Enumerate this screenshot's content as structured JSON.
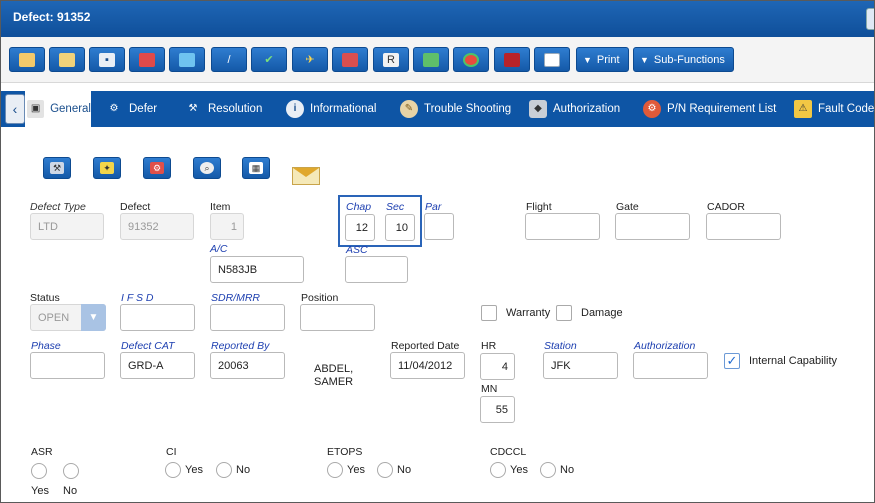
{
  "window": {
    "title": "Defect: 91352"
  },
  "toolbar": {
    "icons": [
      "new-record-icon",
      "copy-icon",
      "save-icon",
      "eraser-icon",
      "notes-icon",
      "attach-icon",
      "check-icon",
      "plane-icon",
      "parts-icon",
      "print-report-icon",
      "transfer-icon",
      "status-icon",
      "delete-icon",
      "window-icon"
    ],
    "print_label": "Print",
    "subfunctions_label": "Sub-Functions"
  },
  "tabs": [
    {
      "label": "General",
      "icon": "general-icon"
    },
    {
      "label": "Defer",
      "icon": "defer-icon"
    },
    {
      "label": "Resolution",
      "icon": "tools-icon"
    },
    {
      "label": "Informational",
      "icon": "info-icon"
    },
    {
      "label": "Trouble Shooting",
      "icon": "troubleshoot-icon"
    },
    {
      "label": "Authorization",
      "icon": "shield-icon"
    },
    {
      "label": "P/N Requirement List",
      "icon": "gears-icon"
    },
    {
      "label": "Fault Code",
      "icon": "warning-icon"
    }
  ],
  "form": {
    "defect_type": {
      "label": "Defect Type",
      "value": "LTD"
    },
    "defect": {
      "label": "Defect",
      "value": "91352"
    },
    "item": {
      "label": "Item",
      "value": "1"
    },
    "chap": {
      "label": "Chap",
      "value": "12"
    },
    "sec": {
      "label": "Sec",
      "value": "10"
    },
    "par": {
      "label": "Par",
      "value": ""
    },
    "flight": {
      "label": "Flight",
      "value": ""
    },
    "gate": {
      "label": "Gate",
      "value": ""
    },
    "cador": {
      "label": "CADOR",
      "value": ""
    },
    "ac": {
      "label": "A/C",
      "value": "N583JB"
    },
    "asc": {
      "label": "ASC",
      "value": ""
    },
    "status": {
      "label": "Status",
      "value": "OPEN"
    },
    "ifsd": {
      "label": "I F S D",
      "value": ""
    },
    "sdr_mrr": {
      "label": "SDR/MRR",
      "value": ""
    },
    "position": {
      "label": "Position",
      "value": ""
    },
    "warranty": {
      "label": "Warranty",
      "checked": false
    },
    "damage": {
      "label": "Damage",
      "checked": false
    },
    "phase": {
      "label": "Phase",
      "value": ""
    },
    "defect_cat": {
      "label": "Defect CAT",
      "value": "GRD-A"
    },
    "reported_by": {
      "label": "Reported By",
      "value": "20063"
    },
    "reporter_name": "ABDEL,\nSAMER",
    "reported_date": {
      "label": "Reported Date",
      "value": "11/04/2012"
    },
    "hr": {
      "label": "HR",
      "value": "4"
    },
    "mn": {
      "label": "MN",
      "value": "55"
    },
    "station": {
      "label": "Station",
      "value": "JFK"
    },
    "authorization": {
      "label": "Authorization",
      "value": ""
    },
    "internal_capability": {
      "label": "Internal Capability",
      "checked": true
    },
    "asr": {
      "label": "ASR",
      "yes": "Yes",
      "no": "No"
    },
    "ci": {
      "label": "CI",
      "yes": "Yes",
      "no": "No"
    },
    "etops": {
      "label": "ETOPS",
      "yes": "Yes",
      "no": "No"
    },
    "cdccl": {
      "label": "CDCCL",
      "yes": "Yes",
      "no": "No"
    }
  }
}
